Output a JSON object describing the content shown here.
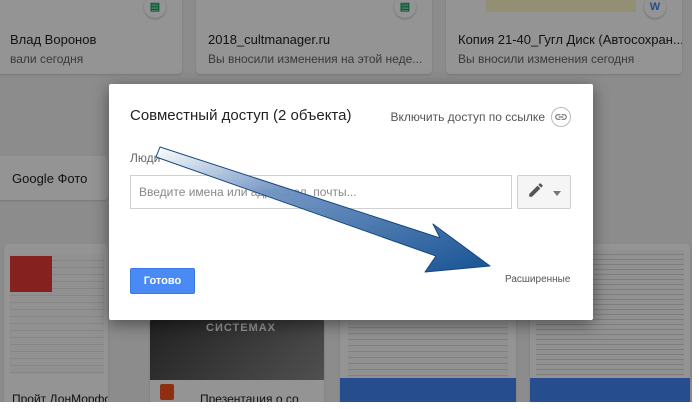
{
  "background": {
    "cards_top": [
      {
        "title": "Влад Воронов",
        "subtitle": "вали сегодня"
      },
      {
        "title": "2018_cultmanager.ru",
        "subtitle": "Вы вносили изменения на этой неде..."
      },
      {
        "title": "Копия 21-40_Гугл Диск (Автосохран...",
        "subtitle": "Вы вносили изменения сегодня"
      }
    ],
    "side_card_label": "Google Фото",
    "bottom_texts": {
      "left": "Пройт ДонМорфо",
      "middle": "Презентация о со",
      "thumb_brand": "СИСТЕМАХ"
    },
    "doc_icon_letter": "W",
    "sheet_icon_letter": "▤"
  },
  "dialog": {
    "title": "Совместный доступ (2 объекта)",
    "link_sharing_label": "Включить доступ по ссылке",
    "people_label": "Люди",
    "people_placeholder": "Введите имена или адреса эл. почты...",
    "done_label": "Готово",
    "advanced_label": "Расширенные"
  },
  "colors": {
    "primary_button": "#4a8af4",
    "arrow": "#0c4a8f",
    "sheets_green": "#0f9d58",
    "docs_blue": "#4285f4"
  }
}
